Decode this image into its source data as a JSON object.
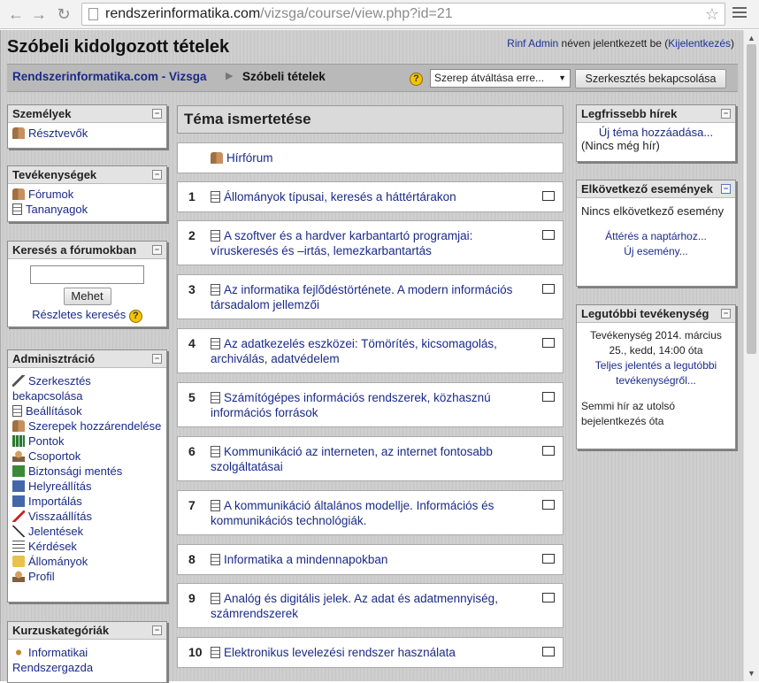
{
  "browser": {
    "url_host": "rendszerinformatika.com",
    "url_path": "/vizsga/course/view.php?id=21"
  },
  "header": {
    "title": "Szóbeli kidolgozott tételek",
    "login_user": "Rinf Admin",
    "login_text": " néven jelentkezett be (",
    "logout": "Kijelentkezés",
    "login_close": ")"
  },
  "navbar": {
    "home": "Rendszerinformatika.com - Vizsga",
    "separator": "▶",
    "current": "Szóbeli tételek",
    "role_select": "Szerep átváltása erre...",
    "edit_button": "Szerkesztés bekapcsolása"
  },
  "left": {
    "people": {
      "title": "Személyek",
      "items": [
        "Résztvevők"
      ]
    },
    "activities": {
      "title": "Tevékenységek",
      "items": [
        "Fórumok",
        "Tananyagok"
      ]
    },
    "search": {
      "title": "Keresés a fórumokban",
      "button": "Mehet",
      "advanced": "Részletes keresés"
    },
    "admin": {
      "title": "Adminisztráció",
      "items": [
        "Szerkesztés bekapcsolása",
        "Beállítások",
        "Szerepek hozzárendelése",
        "Pontok",
        "Csoportok",
        "Biztonsági mentés",
        "Helyreállítás",
        "Importálás",
        "Visszaállítás",
        "Jelentések",
        "Kérdések",
        "Állományok",
        "Profil"
      ]
    },
    "categories": {
      "title": "Kurzuskategóriák",
      "items": [
        "Informatikai Rendszergazda"
      ]
    }
  },
  "main": {
    "title": "Téma ismertetése",
    "forum": "Hírfórum",
    "sections": [
      {
        "num": "1",
        "text": "Állományok típusai, keresés a háttértárakon"
      },
      {
        "num": "2",
        "text": "A szoftver és a hardver karbantartó programjai: víruskeresés és –irtás, lemezkarbantartás"
      },
      {
        "num": "3",
        "text": "Az informatika fejlődéstörténete. A modern információs társadalom jellemzői"
      },
      {
        "num": "4",
        "text": "Az adatkezelés eszközei: Tömörítés, kicsomagolás, archiválás, adatvédelem"
      },
      {
        "num": "5",
        "text": "Számítógépes információs rendszerek, közhasznú információs források"
      },
      {
        "num": "6",
        "text": "Kommunikáció az interneten, az internet fontosabb szolgáltatásai"
      },
      {
        "num": "7",
        "text": "A kommunikáció általános modellje. Információs és kommunikációs technológiák."
      },
      {
        "num": "8",
        "text": "Informatika a mindennapokban"
      },
      {
        "num": "9",
        "text": "Analóg és digitális jelek. Az adat és adatmennyiség, számrendszerek"
      },
      {
        "num": "10",
        "text": "Elektronikus levelezési rendszer használata"
      }
    ]
  },
  "right": {
    "news": {
      "title": "Legfrissebb hírek",
      "add": "Új téma hozzáadása...",
      "none": "(Nincs még hír)"
    },
    "events": {
      "title": "Elkövetkező események",
      "none": "Nincs elkövetkező esemény",
      "calendar": "Áttérés a naptárhoz...",
      "new_event": "Új esemény..."
    },
    "recent": {
      "title": "Legutóbbi tevékenység",
      "since": "Tevékenység 2014. március 25., kedd, 14:00 óta",
      "full_report": "Teljes jelentés a legutóbbi tevékenységről...",
      "nothing": "Semmi hír az utolsó bejelentkezés óta"
    }
  }
}
